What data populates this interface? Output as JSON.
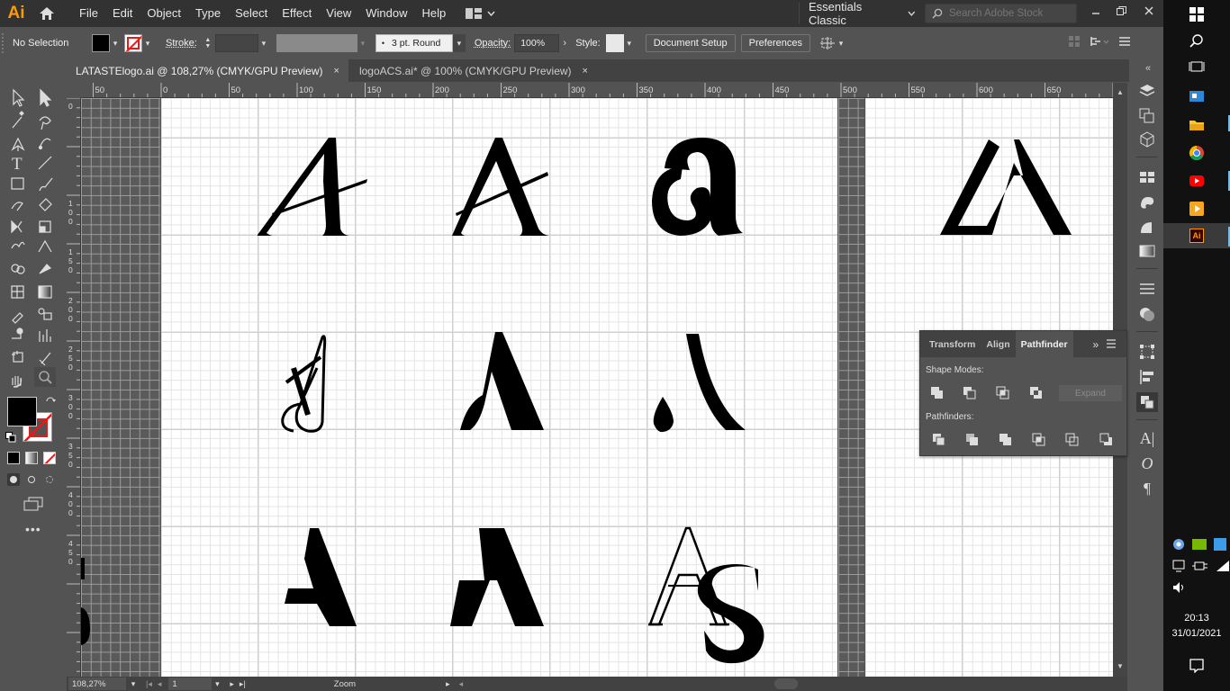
{
  "app": {
    "logo_text": "Ai",
    "menus": [
      "File",
      "Edit",
      "Object",
      "Type",
      "Select",
      "Effect",
      "View",
      "Window",
      "Help"
    ],
    "workspace": "Essentials Classic",
    "search_placeholder": "Search Adobe Stock"
  },
  "control": {
    "selection_status": "No Selection",
    "stroke_label": "Stroke:",
    "brush_value": "3 pt. Round",
    "opacity_label": "Opacity:",
    "opacity_value": "100%",
    "style_label": "Style:",
    "document_setup": "Document Setup",
    "preferences": "Preferences"
  },
  "tabs": [
    {
      "label": "LATASTElogo.ai @ 108,27% (CMYK/GPU Preview)",
      "close": "×",
      "active": true
    },
    {
      "label": "logoACS.ai* @ 100% (CMYK/GPU Preview)",
      "close": "×",
      "active": false
    }
  ],
  "hruler_labels": [
    "50",
    "0",
    "50",
    "100",
    "150",
    "200",
    "250",
    "300",
    "350",
    "400",
    "450",
    "500",
    "550",
    "600",
    "650"
  ],
  "vruler_labels": [
    "0",
    "100",
    "150",
    "200",
    "250",
    "300",
    "350",
    "400",
    "450"
  ],
  "pathfinder": {
    "tabs": [
      "Transform",
      "Align",
      "Pathfinder"
    ],
    "shape_modes_label": "Shape Modes:",
    "expand_label": "Expand",
    "pathfinders_label": "Pathfinders:"
  },
  "status": {
    "zoom": "108,27%",
    "artboard": "1",
    "tool_name": "Zoom"
  },
  "taskbar": {
    "time": "20:13",
    "date": "31/01/2021"
  },
  "colors": {
    "ai_orange": "#ff9a00",
    "ui_dark": "#323232",
    "ui_mid": "#535353",
    "artboard": "#ffffff"
  }
}
